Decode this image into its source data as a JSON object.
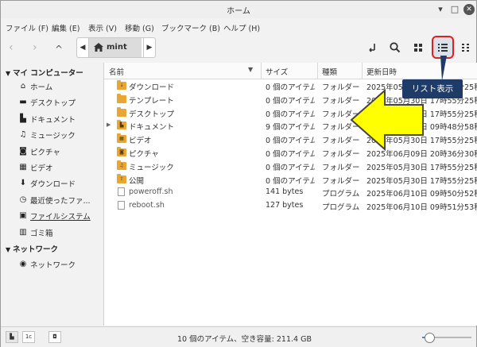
{
  "window": {
    "title": "ホーム",
    "minimize": "▾",
    "maximize": "□",
    "close": "✕"
  },
  "menu": [
    "ファイル (F)",
    "編集 (E)",
    "表示 (V)",
    "移動 (G)",
    "ブックマーク (B)",
    "ヘルプ (H)"
  ],
  "toolbar": {
    "back": "‹",
    "forward": "›",
    "up": "^",
    "path_left": "◀",
    "path_right": "▶",
    "crumb": "mint"
  },
  "sidebar": {
    "my_computer": "マイ コンピューター",
    "items": [
      {
        "label": "ホーム",
        "icon": "home-icon",
        "glyph": "⌂"
      },
      {
        "label": "デスクトップ",
        "icon": "desktop-icon",
        "glyph": "▬"
      },
      {
        "label": "ドキュメント",
        "icon": "document-icon",
        "glyph": "▙"
      },
      {
        "label": "ミュージック",
        "icon": "music-icon",
        "glyph": "♫"
      },
      {
        "label": "ピクチャ",
        "icon": "camera-icon",
        "glyph": "◙"
      },
      {
        "label": "ビデオ",
        "icon": "video-icon",
        "glyph": "▦"
      },
      {
        "label": "ダウンロード",
        "icon": "download-icon",
        "glyph": "⬇"
      },
      {
        "label": "最近使ったファ...",
        "icon": "recent-icon",
        "glyph": "◷"
      },
      {
        "label": "ファイルシステム",
        "icon": "drive-icon",
        "glyph": "▣"
      },
      {
        "label": "ゴミ箱",
        "icon": "trash-icon",
        "glyph": "▥"
      }
    ],
    "network": "ネットワーク",
    "network_items": [
      {
        "label": "ネットワーク",
        "icon": "network-icon",
        "glyph": "◉"
      }
    ]
  },
  "columns": {
    "name": "名前",
    "size": "サイズ",
    "type": "種類",
    "modified": "更新日時"
  },
  "files": [
    {
      "name": "ダウンロード",
      "size": "0 個のアイテム",
      "type": "フォルダー",
      "modified": "2025年05月30日 17時55分25秒",
      "kind": "folder",
      "glyph": "↓"
    },
    {
      "name": "テンプレート",
      "size": "0 個のアイテム",
      "type": "フォルダー",
      "modified": "2025年05月30日 17時55分25秒",
      "kind": "folder",
      "glyph": ""
    },
    {
      "name": "デスクトップ",
      "size": "0 個のアイテム",
      "type": "フォルダー",
      "modified": "2025年05月30日 17時55分25秒",
      "kind": "folder",
      "glyph": ""
    },
    {
      "name": "ドキュメント",
      "size": "9 個のアイテム",
      "type": "フォルダー",
      "modified": "2025年06月10日 09時48分58秒",
      "kind": "folder",
      "glyph": "▙",
      "expandable": true
    },
    {
      "name": "ビデオ",
      "size": "0 個のアイテム",
      "type": "フォルダー",
      "modified": "2025年05月30日 17時55分25秒",
      "kind": "folder",
      "glyph": "▦"
    },
    {
      "name": "ピクチャ",
      "size": "0 個のアイテム",
      "type": "フォルダー",
      "modified": "2025年06月09日 20時36分30秒",
      "kind": "folder",
      "glyph": "◙"
    },
    {
      "name": "ミュージック",
      "size": "0 個のアイテム",
      "type": "フォルダー",
      "modified": "2025年05月30日 17時55分25秒",
      "kind": "folder",
      "glyph": "♫"
    },
    {
      "name": "公開",
      "size": "0 個のアイテム",
      "type": "フォルダー",
      "modified": "2025年05月30日 17時55分25秒",
      "kind": "folder",
      "glyph": "⇪"
    },
    {
      "name": "poweroff.sh",
      "size": "141 bytes",
      "type": "プログラム",
      "modified": "2025年06月10日 09時50分52秒",
      "kind": "file",
      "glyph": ""
    },
    {
      "name": "reboot.sh",
      "size": "127 bytes",
      "type": "プログラム",
      "modified": "2025年06月10日 09時51分53秒",
      "kind": "file",
      "glyph": ""
    }
  ],
  "status": {
    "text": "10 個のアイテム、空き容量: 211.4 GB",
    "zoom": 0.15
  },
  "annotation": {
    "callout": "リスト表示"
  }
}
